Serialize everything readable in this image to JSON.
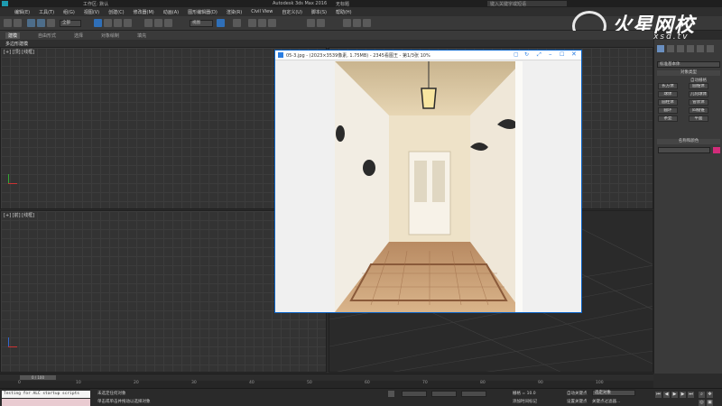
{
  "app": {
    "title": "Autodesk 3ds Max 2016",
    "file": "无标题",
    "workspace": "工作区: 默认",
    "search_placeholder": "键入关键字或短语"
  },
  "menu": [
    "编辑(E)",
    "工具(T)",
    "组(G)",
    "视图(V)",
    "创建(C)",
    "修改器(M)",
    "动画(A)",
    "图形编辑器(D)",
    "渲染(R)",
    "Civil View",
    "自定义(U)",
    "脚本(S)",
    "帮助(H)"
  ],
  "toolbar": {
    "selection_filter": "全部",
    "view_dropdown": "视图"
  },
  "ribbon": {
    "tabs": [
      "建模",
      "自由形式",
      "选择",
      "对象绘制",
      "填充"
    ],
    "sub_label": "多边形建模"
  },
  "viewports": {
    "top": "[+] [顶] [线框]",
    "front": "[+] [前] [线框]"
  },
  "viewer": {
    "caption": "05-3.jpg - (2023×3539像素, 1.75MB) - 2345看图王 - 第1/3张 10%"
  },
  "command_panel": {
    "dropdown": "标准基本体",
    "rollout_object_type": "对象类型",
    "auto_grid": "自动栅格",
    "buttons": [
      "长方体",
      "圆锥体",
      "球体",
      "几何球体",
      "圆柱体",
      "管状体",
      "圆环",
      "四棱锥",
      "茶壶",
      "平面"
    ],
    "rollout_name_color": "名称和颜色"
  },
  "timeline": {
    "frame": "0 / 100",
    "ticks": [
      "0",
      "10",
      "20",
      "30",
      "40",
      "50",
      "60",
      "70",
      "80",
      "90",
      "100"
    ]
  },
  "status": {
    "script_text": "Testing for ALC startup scripts",
    "selection": "未选定任何对象",
    "prompt": "单击或单击并拖动以选择对象",
    "grid": "栅格 = 10.0",
    "add_time_tag": "添加时间标记",
    "auto_key": "自动关键点",
    "set_key": "设置关键点",
    "selected_dropdown": "选定对象",
    "key_filters": "关键点过滤器..."
  },
  "watermark": {
    "brand": "火星网校",
    "url": "www.hxsd.tv"
  }
}
